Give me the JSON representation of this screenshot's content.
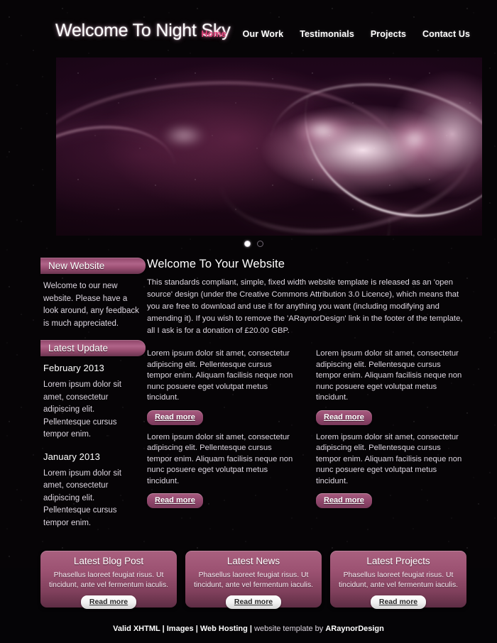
{
  "site": {
    "title": "Welcome To Night Sky",
    "accent_color": "#e0457b",
    "panel_color": "#9c4f73",
    "background_color": "#060406"
  },
  "nav": {
    "items": [
      {
        "label": "Home",
        "active": true
      },
      {
        "label": "Our Work",
        "active": false
      },
      {
        "label": "Testimonials",
        "active": false
      },
      {
        "label": "Projects",
        "active": false
      },
      {
        "label": "Contact Us",
        "active": false
      }
    ]
  },
  "slider": {
    "dots": [
      {
        "label": "1",
        "active": true
      },
      {
        "label": "2",
        "active": false
      }
    ]
  },
  "sidebar": {
    "panels": [
      {
        "heading": "New Website",
        "body": "Welcome to our new website. Please have a look around, any feedback is much appreciated."
      },
      {
        "heading": "Latest Update",
        "entries": [
          {
            "date": "February 2013",
            "body": "Lorem ipsum dolor sit amet, consectetur adipiscing elit. Pellentesque cursus tempor enim."
          },
          {
            "date": "January 2013",
            "body": "Lorem ipsum dolor sit amet, consectetur adipiscing elit. Pellentesque cursus tempor enim."
          }
        ]
      }
    ]
  },
  "content": {
    "heading": "Welcome To Your Website",
    "intro": "This standards compliant, simple, fixed width website template is released as an 'open source' design (under the Creative Commons Attribution 3.0 Licence), which means that you are free to download and use it for anything you want (including modifying and amending it). If you wish to remove the 'ARaynorDesign' link in the footer of the template, all I ask is for a donation of £20.00 GBP.",
    "columns": [
      {
        "body": "Lorem ipsum dolor sit amet, consectetur adipiscing elit. Pellentesque cursus tempor enim. Aliquam facilisis neque non nunc posuere eget volutpat metus tincidunt.",
        "button": "Read more"
      },
      {
        "body": "Lorem ipsum dolor sit amet, consectetur adipiscing elit. Pellentesque cursus tempor enim. Aliquam facilisis neque non nunc posuere eget volutpat metus tincidunt.",
        "button": "Read more"
      },
      {
        "body": "Lorem ipsum dolor sit amet, consectetur adipiscing elit. Pellentesque cursus tempor enim. Aliquam facilisis neque non nunc posuere eget volutpat metus tincidunt.",
        "button": "Read more"
      },
      {
        "body": "Lorem ipsum dolor sit amet, consectetur adipiscing elit. Pellentesque cursus tempor enim. Aliquam facilisis neque non nunc posuere eget volutpat metus tincidunt.",
        "button": "Read more"
      }
    ]
  },
  "boxes": [
    {
      "heading": "Latest Blog Post",
      "body": "Phasellus laoreet feugiat risus. Ut tincidunt, ante vel fermentum iaculis.",
      "button": "Read more"
    },
    {
      "heading": "Latest News",
      "body": "Phasellus laoreet feugiat risus. Ut tincidunt, ante vel fermentum iaculis.",
      "button": "Read more"
    },
    {
      "heading": "Latest Projects",
      "body": "Phasellus laoreet feugiat risus. Ut tincidunt, ante vel fermentum iaculis.",
      "button": "Read more"
    }
  ],
  "footer": {
    "links": [
      {
        "label": "Valid XHTML"
      },
      {
        "label": "Images"
      },
      {
        "label": "Web Hosting"
      }
    ],
    "separator": " | ",
    "credit_text": "website template by ",
    "credit_link": "ARaynorDesign"
  }
}
